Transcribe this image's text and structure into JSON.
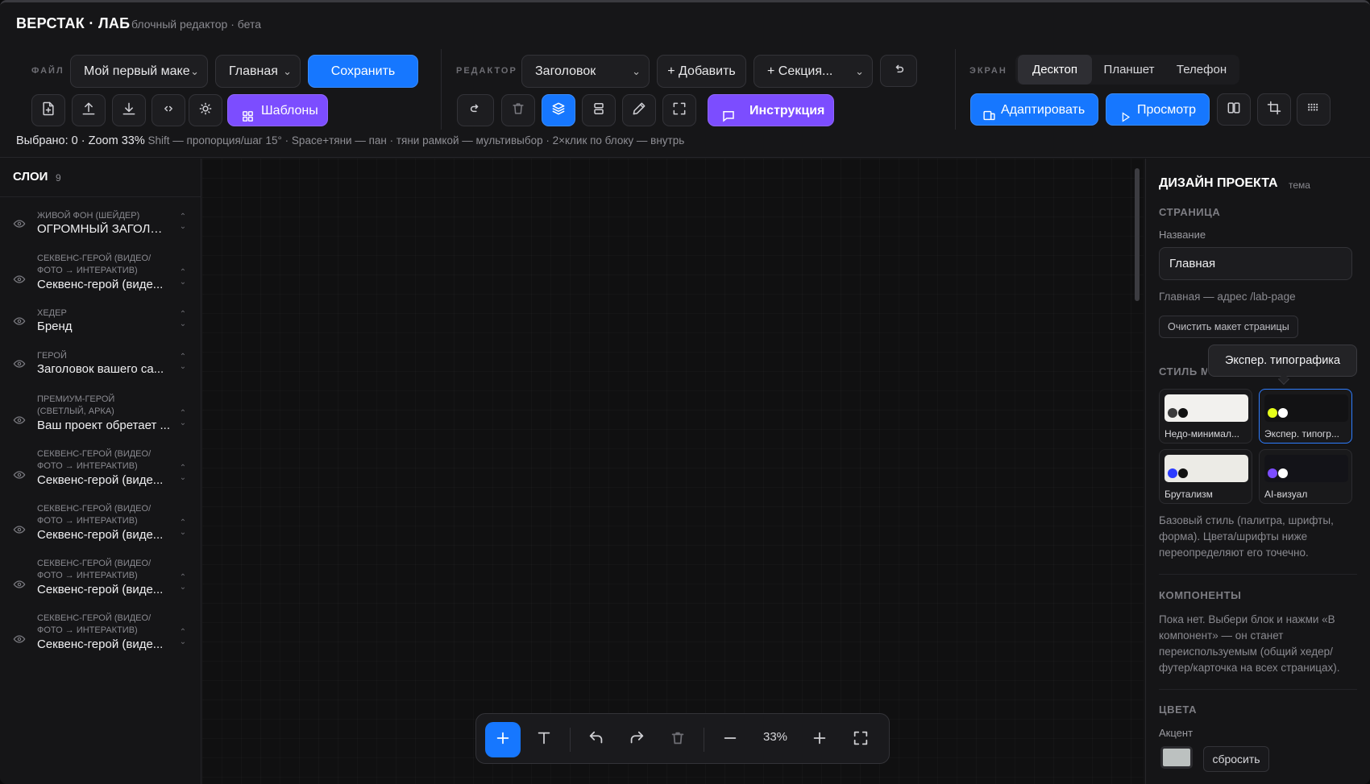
{
  "header": {
    "brand": "ВЕРСТАК · ЛАБ",
    "subtitle": "блочный редактор · бета"
  },
  "file_group": {
    "label": "ФАЙЛ",
    "project_select": "Мой первый маке",
    "page_select": "Главная",
    "save_label": "Сохранить",
    "templates_label": "Шаблоны",
    "icons": [
      "new-file-icon",
      "upload-icon",
      "download-icon",
      "code-icon",
      "brightness-icon"
    ]
  },
  "editor_group": {
    "label": "РЕДАКТОР",
    "block_select": "Заголовок",
    "add_label": "+ Добавить",
    "section_select": "+ Секция...",
    "instruction_label": "Инструкция",
    "icons": [
      "undo-icon",
      "redo-icon",
      "trash-icon",
      "layers-icon",
      "stack-icon",
      "pen-icon",
      "expand-icon",
      "message-icon"
    ]
  },
  "screen_group": {
    "label": "ЭКРАН",
    "tabs": [
      {
        "label": "Десктоп",
        "active": true
      },
      {
        "label": "Планшет",
        "active": false
      },
      {
        "label": "Телефон",
        "active": false
      }
    ],
    "adapt_label": "Адаптировать",
    "preview_label": "Просмотр",
    "icons": [
      "split-view-icon",
      "crop-icon",
      "grid-icon"
    ]
  },
  "status_bar": {
    "selection": "Выбрано: 0 · Zoom 33%",
    "hints": "Shift — пропорция/шаг 15° · Space+тяни — пан · тяни рамкой — мультивыбор · 2×клик по блоку — внутрь"
  },
  "layers": {
    "title": "СЛОИ",
    "count": "9",
    "items": [
      {
        "category": "ЖИВОЙ ФОН (ШЕЙДЕР)",
        "name": "ОГРОМНЫЙ ЗАГОЛОВ..."
      },
      {
        "category": "СЕКВЕНС-ГЕРОЙ (ВИДЕО/ФОТО → ИНТЕРАКТИВ)",
        "name": "Секвенс-герой (виде..."
      },
      {
        "category": "ХЕДЕР",
        "name": "Бренд"
      },
      {
        "category": "ГЕРОЙ",
        "name": "Заголовок вашего са..."
      },
      {
        "category": "ПРЕМИУМ-ГЕРОЙ (СВЕТЛЫЙ, АРКА)",
        "name": "Ваш проект обретает ..."
      },
      {
        "category": "СЕКВЕНС-ГЕРОЙ (ВИДЕО/ФОТО → ИНТЕРАКТИВ)",
        "name": "Секвенс-герой (виде..."
      },
      {
        "category": "СЕКВЕНС-ГЕРОЙ (ВИДЕО/ФОТО → ИНТЕРАКТИВ)",
        "name": "Секвенс-герой (виде..."
      },
      {
        "category": "СЕКВЕНС-ГЕРОЙ (ВИДЕО/ФОТО → ИНТЕРАКТИВ)",
        "name": "Секвенс-герой (виде..."
      },
      {
        "category": "СЕКВЕНС-ГЕРОЙ (ВИДЕО/ФОТО → ИНТЕРАКТИВ)",
        "name": "Секвенс-герой (виде..."
      }
    ]
  },
  "dock": {
    "zoom": "33%",
    "icons": [
      "plus-icon",
      "text-icon",
      "undo-icon",
      "redo-icon",
      "trash-icon",
      "zoom-out-icon",
      "zoom-in-icon",
      "fullscreen-icon"
    ]
  },
  "design_panel": {
    "title": "ДИЗАЙН ПРОЕКТА",
    "subtitle": "тема",
    "page_section": "СТРАНИЦА",
    "name_label": "Название",
    "name_value": "Главная",
    "address_hint": "Главная — адрес /lab-page",
    "clear_label": "Очистить макет страницы",
    "style_section": "СТИЛЬ МАКЕТА",
    "tooltip": "Экспер. типографика",
    "styles": [
      {
        "label": "Недо-минимал...",
        "bg": "#f2f1ee",
        "dots": [
          "#3a3a3a",
          "#111111"
        ],
        "selected": false
      },
      {
        "label": "Экспер. типогр...",
        "bg": "#121214",
        "dots": [
          "#e6ff1a",
          "#ffffff"
        ],
        "selected": true
      },
      {
        "label": "Брутализм",
        "bg": "#ecebe6",
        "dots": [
          "#2b3bff",
          "#111111"
        ],
        "selected": false
      },
      {
        "label": "AI-визуал",
        "bg": "#131318",
        "dots": [
          "#7c4dff",
          "#ffffff"
        ],
        "selected": false
      }
    ],
    "style_hint": "Базовый стиль (палитра, шрифты, форма). Цвета/шрифты ниже переопределяют его точечно.",
    "components_section": "КОМПОНЕНТЫ",
    "components_hint": "Пока нет. Выбери блок и нажми «В компонент» — он станет переиспользуемым (общий хедер/футер/карточка на всех страницах).",
    "colors_section": "ЦВЕТА",
    "accent_label": "Акцент",
    "accent_color": "#bcc1c0",
    "reset_label": "сбросить"
  },
  "colors": {
    "accent_blue": "#1677ff",
    "accent_purple": "#7c4dff"
  }
}
